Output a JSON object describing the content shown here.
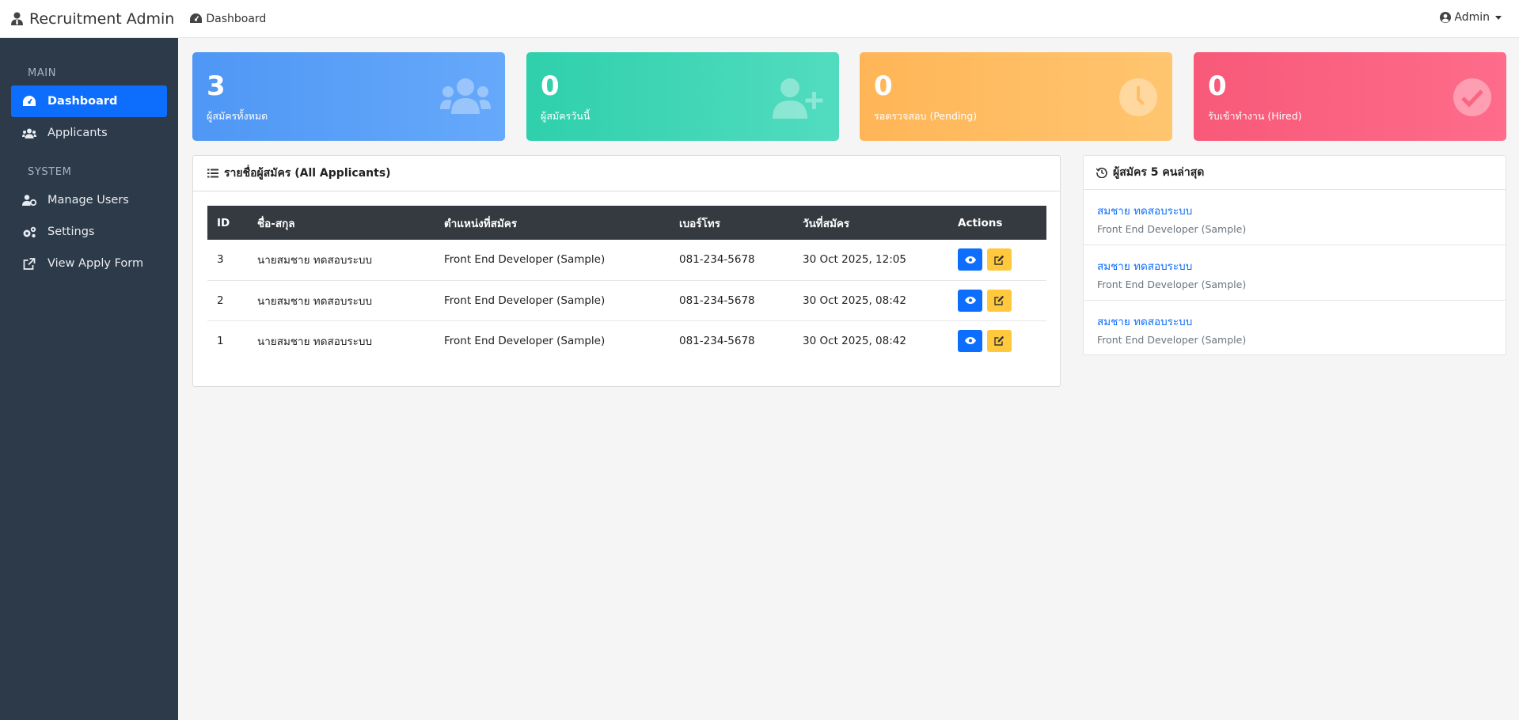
{
  "topbar": {
    "brand": "Recruitment Admin",
    "breadcrumb": "Dashboard",
    "user": "Admin"
  },
  "sidebar": {
    "sections": [
      {
        "label": "MAIN",
        "items": [
          {
            "label": "Dashboard",
            "icon": "gauge-icon",
            "active": true
          },
          {
            "label": "Applicants",
            "icon": "users-icon"
          }
        ]
      },
      {
        "label": "SYSTEM",
        "items": [
          {
            "label": "Manage Users",
            "icon": "user-gear-icon"
          },
          {
            "label": "Settings",
            "icon": "gears-icon"
          },
          {
            "label": "View Apply Form",
            "icon": "external-link-icon"
          }
        ]
      }
    ]
  },
  "stats": [
    {
      "value": "3",
      "label": "ผู้สมัครทั้งหมด",
      "icon": "users-icon",
      "color": "#4f97f5"
    },
    {
      "value": "0",
      "label": "ผู้สมัครวันนี้",
      "icon": "user-plus-icon",
      "color": "#2fd0ac"
    },
    {
      "value": "0",
      "label": "รอตรวจสอบ (Pending)",
      "icon": "clock-icon",
      "color": "#ffb557"
    },
    {
      "value": "0",
      "label": "รับเข้าทำงาน (Hired)",
      "icon": "check-circle-icon",
      "color": "#f85978"
    }
  ],
  "applicants_panel": {
    "title": "รายชื่อผู้สมัคร (All Applicants)",
    "columns": [
      "ID",
      "ชื่อ-สกุล",
      "ตำแหน่งที่สมัคร",
      "เบอร์โทร",
      "วันที่สมัคร",
      "Actions"
    ],
    "rows": [
      {
        "id": "3",
        "name": "นายสมชาย ทดสอบระบบ",
        "position": "Front End Developer (Sample)",
        "phone": "081-234-5678",
        "date": "30 Oct 2025, 12:05"
      },
      {
        "id": "2",
        "name": "นายสมชาย ทดสอบระบบ",
        "position": "Front End Developer (Sample)",
        "phone": "081-234-5678",
        "date": "30 Oct 2025, 08:42"
      },
      {
        "id": "1",
        "name": "นายสมชาย ทดสอบระบบ",
        "position": "Front End Developer (Sample)",
        "phone": "081-234-5678",
        "date": "30 Oct 2025, 08:42"
      }
    ]
  },
  "recent_panel": {
    "title": "ผู้สมัคร 5 คนล่าสุด",
    "items": [
      {
        "name": "สมชาย ทดสอบระบบ",
        "position": "Front End Developer (Sample)"
      },
      {
        "name": "สมชาย ทดสอบระบบ",
        "position": "Front End Developer (Sample)"
      },
      {
        "name": "สมชาย ทดสอบระบบ",
        "position": "Front End Developer (Sample)"
      }
    ]
  },
  "colors": {
    "primary": "#0d6efd",
    "sidebar": "#2c3a4a",
    "table_header": "#343a40",
    "edit_button": "#ffc83d"
  }
}
